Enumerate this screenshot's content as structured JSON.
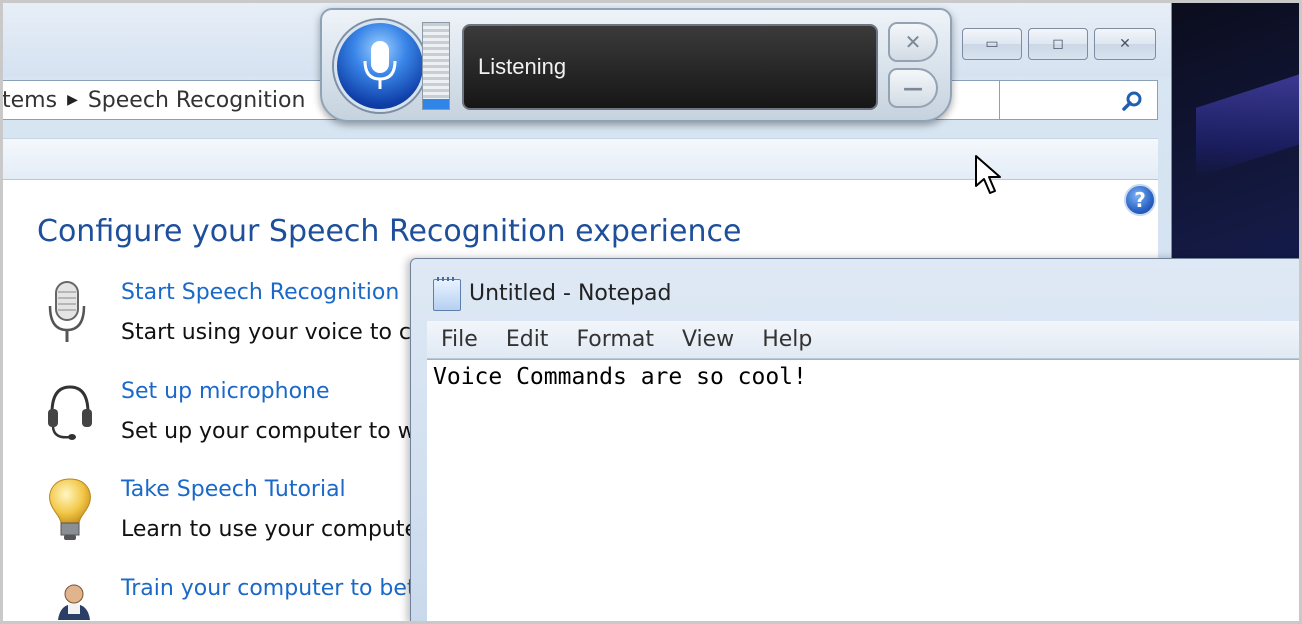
{
  "control_panel": {
    "breadcrumb": [
      "tems",
      "Speech Recognition"
    ],
    "page_title": "Configure your Speech Recognition experience",
    "tasks": [
      {
        "icon": "microphone-icon",
        "link": "Start Speech Recognition",
        "description": "Start using your voice to co"
      },
      {
        "icon": "headset-icon",
        "link": "Set up microphone",
        "description": "Set up your computer to wo"
      },
      {
        "icon": "lightbulb-icon",
        "link": "Take Speech Tutorial",
        "description": "Learn to use your computer"
      },
      {
        "icon": "user-training-icon",
        "link": "Train your computer to bett",
        "description": ""
      }
    ],
    "caption_buttons": {
      "minimize": "▭",
      "restore": "◻",
      "close": "✕"
    },
    "help_glyph": "?",
    "search_glyph": "🔍"
  },
  "speech_bar": {
    "status": "Listening",
    "meter_level": 0.12,
    "close_glyph": "✕",
    "minimize_glyph": "—"
  },
  "notepad": {
    "title": "Untitled - Notepad",
    "menu": [
      "File",
      "Edit",
      "Format",
      "View",
      "Help"
    ],
    "text": "Voice Commands are so cool!"
  },
  "colors": {
    "link": "#1a69c9",
    "title": "#1e4f9a",
    "mic_blue": "#3a86e8"
  }
}
